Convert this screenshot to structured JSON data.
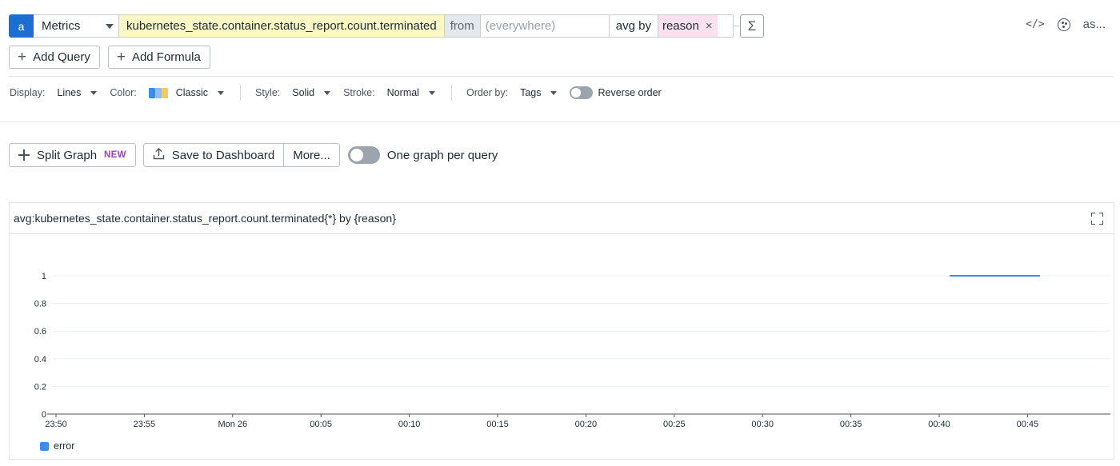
{
  "query": {
    "letter": "a",
    "source": "Metrics",
    "metric": "kubernetes_state.container.status_report.count.terminated",
    "from_label": "from",
    "scope_placeholder": "(everywhere)",
    "aggregation_label": "avg by",
    "group_tag": "reason",
    "remove_tag": "×",
    "formula_icon": "Σ"
  },
  "top_right": {
    "code_icon": "</>",
    "more_text": "as..."
  },
  "add_buttons": {
    "add_query": "Add Query",
    "add_formula": "Add Formula",
    "plus": "+"
  },
  "display_options": {
    "display_label": "Display:",
    "display_value": "Lines",
    "color_label": "Color:",
    "color_value": "Classic",
    "color_swatch": [
      "#3b8ee8",
      "#8fbdf2",
      "#f1c86a"
    ],
    "style_label": "Style:",
    "style_value": "Solid",
    "stroke_label": "Stroke:",
    "stroke_value": "Normal",
    "order_label": "Order by:",
    "order_value": "Tags",
    "reverse_label": "Reverse order"
  },
  "actions": {
    "split_graph": "Split Graph",
    "new_badge": "NEW",
    "save_dashboard": "Save to Dashboard",
    "more": "More...",
    "one_graph_per_query": "One graph per query"
  },
  "graph": {
    "title": "avg:kubernetes_state.container.status_report.count.terminated{*} by {reason}",
    "legend": [
      {
        "name": "error",
        "color": "#3b8ee8"
      }
    ]
  },
  "chart_data": {
    "type": "line",
    "x_ticks": [
      "23:50",
      "23:55",
      "Mon 26",
      "00:05",
      "00:10",
      "00:15",
      "00:20",
      "00:25",
      "00:30",
      "00:35",
      "00:40",
      "00:45"
    ],
    "y_ticks": [
      "0",
      "0.2",
      "0.4",
      "0.6",
      "0.8",
      "1"
    ],
    "ylim": [
      0,
      1
    ],
    "x_minutes_range": [
      0,
      60
    ],
    "series": [
      {
        "name": "error",
        "color": "#3b8ee8",
        "points": [
          [
            50.6,
            1
          ],
          [
            55.7,
            1
          ]
        ]
      }
    ]
  }
}
